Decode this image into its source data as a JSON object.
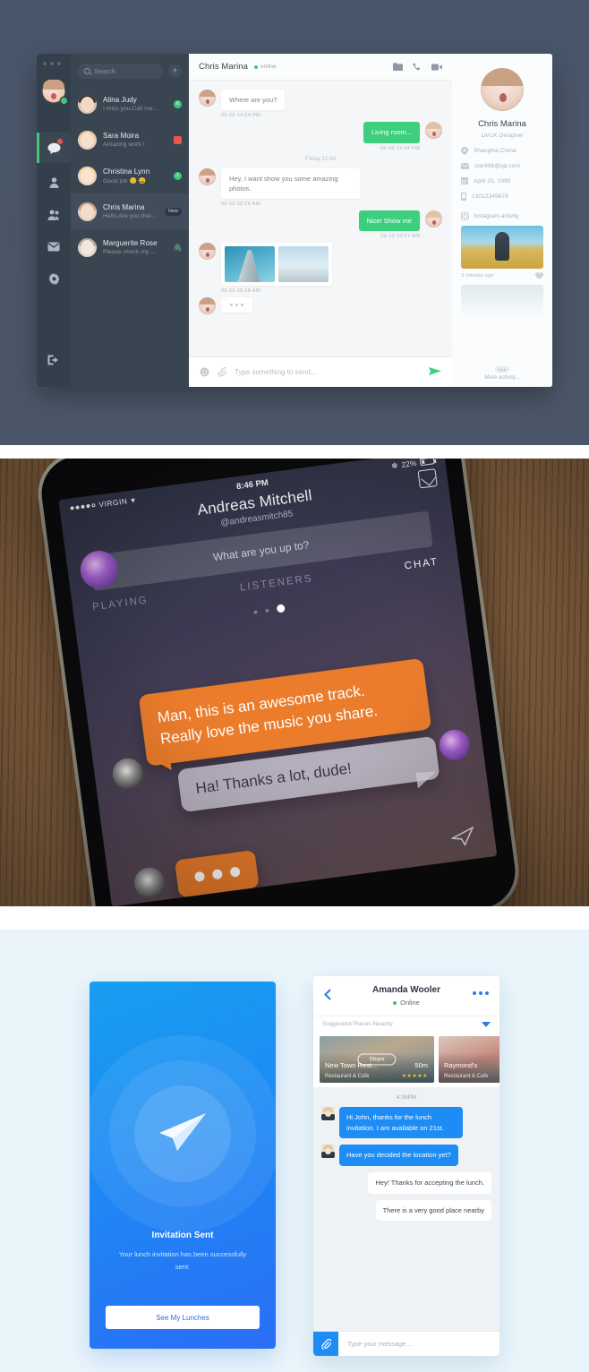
{
  "desktop": {
    "search": {
      "placeholder": "Search",
      "icon": "search-icon"
    },
    "add_label": "+",
    "conversations": [
      {
        "name": "Alina Judy",
        "preview": "I miss you,Call me...",
        "badge": "6",
        "badge_type": "count"
      },
      {
        "name": "Sara Moira",
        "preview": "Amazing work !",
        "badge": "",
        "badge_type": "square"
      },
      {
        "name": "Christina Lynn",
        "preview": "Good job 😊 😄",
        "badge": "1",
        "badge_type": "count"
      },
      {
        "name": "Chris Marina",
        "preview": "Hello,Are you there...",
        "badge": "New",
        "badge_type": "tag"
      },
      {
        "name": "Marguerite Rose",
        "preview": "Please check my ...",
        "badge": "🖇",
        "badge_type": "clip"
      }
    ],
    "header": {
      "title": "Chris Marina",
      "status": "online",
      "icons": [
        "folder-icon",
        "phone-icon",
        "video-icon"
      ]
    },
    "messages": [
      {
        "side": "in",
        "text": "Where are you?",
        "time": "06-09  14:24 PM"
      },
      {
        "side": "out",
        "text": "Living room...",
        "time": "06-09  14:24 PM"
      },
      {
        "side": "in",
        "text": "Hey,  I want show you some amazing photos.",
        "time": "06-10  10:26 AM"
      },
      {
        "side": "out",
        "text": "Nice! Show me",
        "time": "06-10   10:27 AM"
      },
      {
        "side": "in",
        "text": "",
        "time": "06-10  10:28 AM",
        "type": "photos"
      },
      {
        "side": "in",
        "text": "",
        "time": "",
        "type": "typing"
      }
    ],
    "day_divider": "Friday 12:34",
    "input": {
      "placeholder": "Type something to send...",
      "icons": [
        "emoji-icon",
        "attach-icon",
        "send-icon"
      ]
    },
    "profile": {
      "name": "Chris Marina",
      "role": "UI/UX Designer",
      "details": [
        {
          "icon": "location-icon",
          "value": "Shanghai,China"
        },
        {
          "icon": "mail-icon",
          "value": "star666@qq.com"
        },
        {
          "icon": "calendar-icon",
          "value": "April 25,  1990"
        },
        {
          "icon": "phone-icon",
          "value": "13012345678"
        }
      ],
      "activity_title": "Instagram activity",
      "activity_time": "3 minutes ago",
      "more_label": "More activity..."
    },
    "rail_icons": [
      "chat-icon",
      "contact-icon",
      "group-icon",
      "mail-icon",
      "settings-icon",
      "logout-icon"
    ],
    "colors": {
      "accent_green": "#3ecf7e",
      "sidebar_dark": "#3a4552",
      "rail_dark": "#343f4c",
      "alert_red": "#e8544f"
    }
  },
  "phone": {
    "status": {
      "carrier": "VIRGIN",
      "time": "8:46 PM",
      "battery": "22%",
      "bluetooth": "bluetooth-icon"
    },
    "title": "Andreas Mitchell",
    "handle": "@andreasmitch85",
    "search_placeholder": "What are you up to?",
    "tabs": [
      {
        "label": "PLAYING",
        "active": false
      },
      {
        "label": "LISTENERS",
        "active": false
      },
      {
        "label": "CHAT",
        "active": true
      }
    ],
    "messages": [
      {
        "side": "in",
        "text": "Man, this is an awesome track. Really love the music you share."
      },
      {
        "side": "out",
        "text": "Ha! Thanks a lot, dude!"
      },
      {
        "side": "in",
        "text": "",
        "type": "typing"
      }
    ],
    "colors": {
      "bubble_orange": "#ea7c2b",
      "bubble_gray": "#dcdae6"
    }
  },
  "invitation": {
    "icon": "paper-plane-icon",
    "title": "Invitation Sent",
    "subtitle": "Your lunch invitation has been successfully sent.",
    "button_label": "See My Lunches",
    "colors": {
      "blue_start": "#179ff0",
      "blue_end": "#2a6ef5"
    }
  },
  "lunch_chat": {
    "header": {
      "name": "Amanda Wooler",
      "status": "Online",
      "back": "back-icon",
      "more": "more-icon"
    },
    "suggested_label": "Suggested Places Nearby",
    "places": [
      {
        "name": "New Town Rest...",
        "subtitle": "Restaurant & Cafe",
        "distance": "50m",
        "stars": "★★★★★",
        "share_label": "Share"
      },
      {
        "name": "Raymond's",
        "subtitle": "Restaurant & Cafe",
        "distance": "",
        "stars": "",
        "share_label": ""
      }
    ],
    "timestamp": "4:39PM",
    "messages": [
      {
        "side": "in",
        "text": "Hi John, thanks for the lunch invitation. I am available on 21st."
      },
      {
        "side": "in",
        "text": "Have you decided the location yet?"
      },
      {
        "side": "out",
        "text": "Hey! Thanks for accepting the lunch."
      },
      {
        "side": "out",
        "text": "There is a very good place nearby"
      }
    ],
    "input": {
      "placeholder": "Type your message...",
      "icon": "attach-icon"
    },
    "colors": {
      "accent_blue": "#1d8cf5"
    }
  }
}
